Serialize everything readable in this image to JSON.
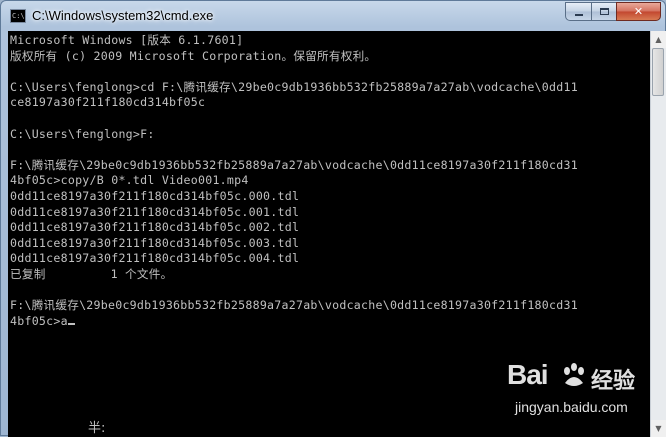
{
  "window": {
    "title": "C:\\Windows\\system32\\cmd.exe",
    "icon_label": "C:\\"
  },
  "console": {
    "lines": [
      "Microsoft Windows [版本 6.1.7601]",
      "版权所有 (c) 2009 Microsoft Corporation。保留所有权利。",
      "",
      "C:\\Users\\fenglong>cd F:\\腾讯缓存\\29be0c9db1936bb532fb25889a7a27ab\\vodcache\\0dd11",
      "ce8197a30f211f180cd314bf05c",
      "",
      "C:\\Users\\fenglong>F:",
      "",
      "F:\\腾讯缓存\\29be0c9db1936bb532fb25889a7a27ab\\vodcache\\0dd11ce8197a30f211f180cd31",
      "4bf05c>copy/B 0*.tdl Video001.mp4",
      "0dd11ce8197a30f211f180cd314bf05c.000.tdl",
      "0dd11ce8197a30f211f180cd314bf05c.001.tdl",
      "0dd11ce8197a30f211f180cd314bf05c.002.tdl",
      "0dd11ce8197a30f211f180cd314bf05c.003.tdl",
      "0dd11ce8197a30f211f180cd314bf05c.004.tdl",
      "已复制         1 个文件。",
      "",
      "F:\\腾讯缓存\\29be0c9db1936bb532fb25889a7a27ab\\vodcache\\0dd11ce8197a30f211f180cd31"
    ],
    "prompt_line": "4bf05c>a",
    "ime_status": "半:"
  },
  "watermark": {
    "logo": "Bai",
    "logo_suffix": "",
    "cn": "经验",
    "url": "jingyan.baidu.com"
  },
  "colors": {
    "console_bg": "#000000",
    "console_text": "#c0c0c0",
    "close_button": "#c2462f"
  },
  "icons": {
    "minimize": "minimize-icon",
    "maximize": "maximize-icon",
    "close": "close-icon",
    "scroll_up": "scroll-up-arrow-icon",
    "scroll_down": "scroll-down-arrow-icon"
  }
}
